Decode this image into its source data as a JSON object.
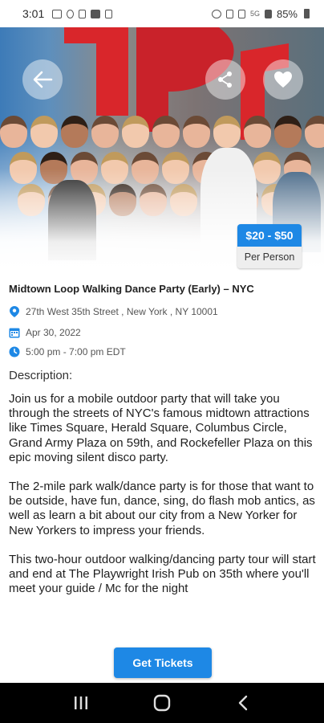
{
  "status_bar": {
    "time": "3:01",
    "network": "5G",
    "battery": "85%"
  },
  "event": {
    "price_range": "$20 - $50",
    "price_unit": "Per Person",
    "title": "Midtown Loop Walking Dance Party (Early) – NYC",
    "address": "27th West 35th Street , New York , NY 10001",
    "date": "Apr 30, 2022",
    "time": "5:00 pm - 7:00 pm EDT"
  },
  "description": {
    "heading": "Description:",
    "paragraphs": [
      "Join us for a mobile outdoor party that will take you through the streets of NYC's famous midtown attractions like Times Square, Herald Square, Columbus Circle, Grand Army Plaza on 59th, and Rockefeller Plaza on this epic moving silent disco party.",
      "The 2-mile park walk/dance party is for those that want to be outside, have fun, dance, sing, do flash mob antics, as well as learn a bit about our city from a New Yorker for New Yorkers to impress your friends.",
      "This two-hour outdoor walking/dancing party tour will start and end at The Playwright Irish Pub on 35th where you'll meet your guide / Mc for the night"
    ]
  },
  "actions": {
    "get_tickets": "Get Tickets"
  },
  "icons": {
    "back": "arrow-left-icon",
    "share": "share-icon",
    "favorite": "heart-icon",
    "location": "location-pin-icon",
    "calendar": "calendar-icon",
    "clock": "clock-icon",
    "nav_recents": "recents-icon",
    "nav_home": "home-icon",
    "nav_back": "back-chevron-icon"
  },
  "colors": {
    "accent": "#1e88e5",
    "price_bg": "#eeeeee",
    "nav_bar": "#000000"
  }
}
